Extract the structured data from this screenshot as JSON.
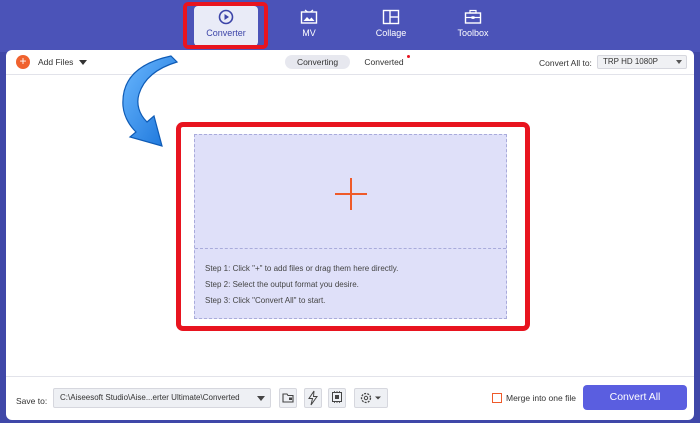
{
  "nav": {
    "items": [
      {
        "label": "Converter",
        "icon": "converter-icon",
        "active": true
      },
      {
        "label": "MV",
        "icon": "mv-icon"
      },
      {
        "label": "Collage",
        "icon": "collage-icon"
      },
      {
        "label": "Toolbox",
        "icon": "toolbox-icon"
      }
    ]
  },
  "toolbar": {
    "add_files_label": "Add Files",
    "tabs": [
      {
        "label": "Converting",
        "active": true
      },
      {
        "label": "Converted",
        "has_dot": true
      }
    ],
    "convert_all_label": "Convert All to:",
    "format_value": "TRP HD 1080P"
  },
  "drop_zone": {
    "steps": [
      "Step 1: Click \"+\" to add files or drag them here directly.",
      "Step 2: Select the output format you desire.",
      "Step 3: Click \"Convert All\" to start."
    ]
  },
  "footer": {
    "save_to_label": "Save to:",
    "save_path": "C:\\Aiseesoft Studio\\Aise...erter Ultimate\\Converted",
    "merge_label": "Merge into one file",
    "convert_all_button": "Convert All"
  },
  "colors": {
    "accent": "#5a5ee0",
    "highlight": "#e8141f",
    "topbar": "#4b53b8",
    "drop_zone": "#dfe0f9",
    "orange": "#f0622e",
    "annotation_arrow": "#2f8cf0"
  }
}
